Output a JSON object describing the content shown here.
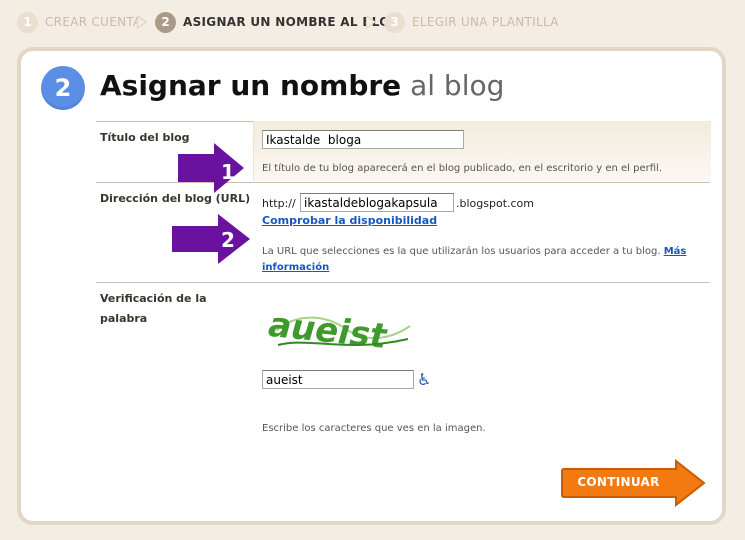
{
  "steps": [
    {
      "num": "1",
      "label": "CREAR CUENTA"
    },
    {
      "num": "2",
      "label": "ASIGNAR UN NOMBRE AL BLOG"
    },
    {
      "num": "3",
      "label": "ELEGIR UNA PLANTILLA"
    }
  ],
  "header": {
    "badge": "2",
    "title_strong": "Asignar un nombre",
    "title_light": "al blog"
  },
  "form": {
    "title_label": "Título del blog",
    "title_value": "Ikastalde  bloga",
    "title_help": "El título de tu blog aparecerá en el blog publicado, en el escritorio y en el perfil.",
    "url_label": "Dirección del blog (URL)",
    "url_prefix": "http://",
    "url_value": "ikastaldeblogakapsula",
    "url_suffix": ".blogspot.com",
    "check_link": "Comprobar la disponibilidad",
    "url_help": "La URL que selecciones es la que utilizarán los usuarios para acceder a tu blog.",
    "more_info": "Más información",
    "verify_label_1": "Verificación de la",
    "verify_label_2": "palabra",
    "captcha_text": "aueist",
    "verify_value": "aueist",
    "verify_help": "Escribe los caracteres que ves en la imagen.",
    "continue_label": "CONTINUAR"
  },
  "annotations": {
    "arrow1": "1",
    "arrow2": "2"
  },
  "colors": {
    "badge_blue": "#5b8fe6",
    "continue_orange": "#f27a10",
    "annotation_purple": "#6a12a0",
    "link_blue": "#1557c0"
  }
}
